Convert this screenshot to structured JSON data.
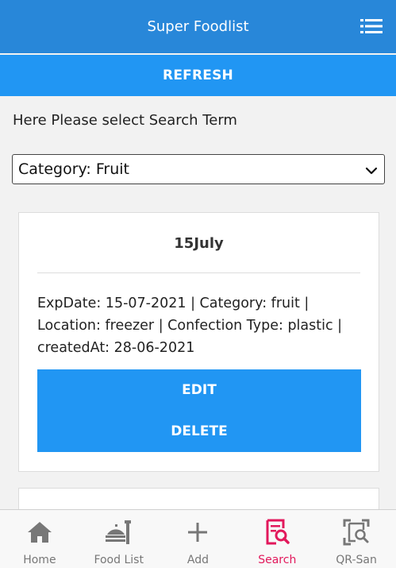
{
  "header": {
    "title": "Super Foodlist",
    "menu_icon": "list-icon"
  },
  "refresh_label": "REFRESH",
  "search": {
    "prompt": "Here Please select Search Term",
    "selected": "Category: Fruit"
  },
  "cards": [
    {
      "title": "15July",
      "details": "ExpDate: 15-07-2021 | Category: fruit | Location: freezer | Confection Type: plastic | createdAt: 28-06-2021",
      "edit_label": "EDIT",
      "delete_label": "DELETE"
    }
  ],
  "nav": [
    {
      "label": "Home",
      "icon": "home-icon",
      "active": false
    },
    {
      "label": "Food List",
      "icon": "food-icon",
      "active": false
    },
    {
      "label": "Add",
      "icon": "plus-icon",
      "active": false
    },
    {
      "label": "Search",
      "icon": "search-list-icon",
      "active": true
    },
    {
      "label": "QR-San",
      "icon": "qr-search-icon",
      "active": false
    }
  ],
  "colors": {
    "header": "#2887d9",
    "primary": "#2196f3",
    "active_tab": "#e2185b",
    "inactive_tab": "#777777"
  }
}
